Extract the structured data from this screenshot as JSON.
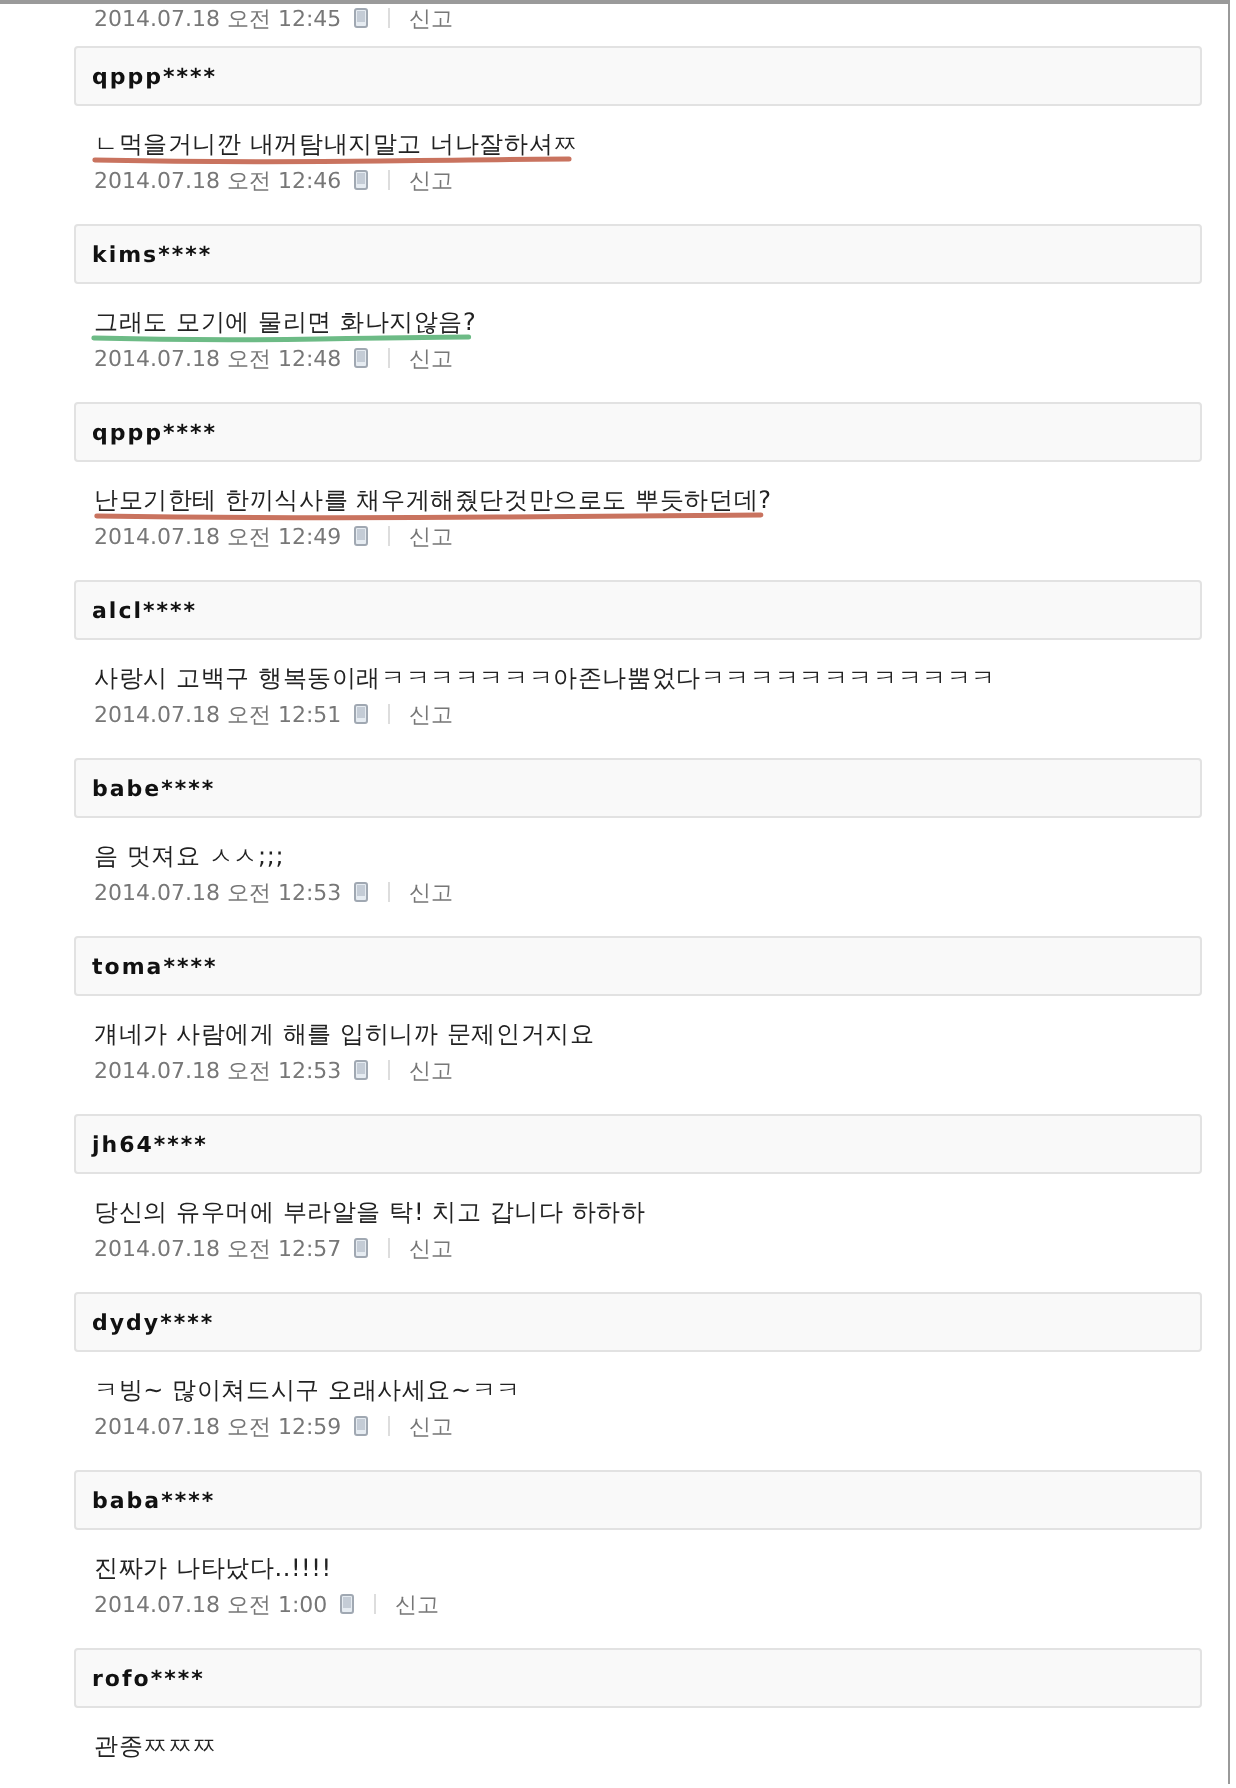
{
  "top_meta": {
    "time": "2014.07.18 오전 12:45",
    "report": "신고"
  },
  "comments": [
    {
      "user": "qppp****",
      "text": "ㄴ먹을거니깐 내꺼탐내지말고 너나잘하셔ㅉ",
      "time": "2014.07.18 오전 12:46",
      "report": "신고",
      "color": "#c9735f"
    },
    {
      "user": "kims****",
      "text": "그래도 모기에 물리면 화나지않음?",
      "time": "2014.07.18 오전 12:48",
      "report": "신고",
      "color": "#6dbb86"
    },
    {
      "user": "qppp****",
      "text": "난모기한테 한끼식사를 채우게해줬단것만으로도 뿌듯하던데?",
      "time": "2014.07.18 오전 12:49",
      "report": "신고",
      "color": "#c9735f"
    },
    {
      "user": "alcl****",
      "text": "사랑시 고백구 행복동이래ㅋㅋㅋㅋㅋㅋㅋ아존나뿜었다ㅋㅋㅋㅋㅋㅋㅋㅋㅋㅋㅋㅋ",
      "time": "2014.07.18 오전 12:51",
      "report": "신고"
    },
    {
      "user": "babe****",
      "text": "음 멋져요 ㅅㅅ;;;",
      "time": "2014.07.18 오전 12:53",
      "report": "신고"
    },
    {
      "user": "toma****",
      "text": "걔네가 사람에게 해를 입히니까 문제인거지요",
      "time": "2014.07.18 오전 12:53",
      "report": "신고"
    },
    {
      "user": "jh64****",
      "text": "당신의 유우머에 부라알을 탁! 치고 갑니다 하하하",
      "time": "2014.07.18 오전 12:57",
      "report": "신고"
    },
    {
      "user": "dydy****",
      "text": "ㅋ빙~ 많이쳐드시구 오래사세요~ㅋㅋ",
      "time": "2014.07.18 오전 12:59",
      "report": "신고"
    },
    {
      "user": "baba****",
      "text": "진짜가 나타났다..!!!!",
      "time": "2014.07.18 오전 1:00",
      "report": "신고"
    },
    {
      "user": "rofo****",
      "text": "관종ㅉㅉㅉ"
    }
  ]
}
